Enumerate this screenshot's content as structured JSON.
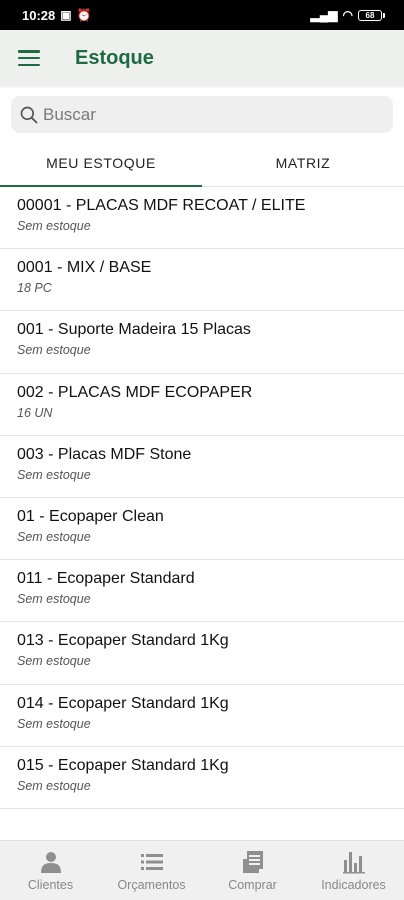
{
  "status_bar": {
    "time": "10:28",
    "battery": "68"
  },
  "app_bar": {
    "title": "Estoque"
  },
  "search": {
    "placeholder": "Buscar"
  },
  "tabs": [
    {
      "label": "MEU ESTOQUE",
      "active": true
    },
    {
      "label": "MATRIZ",
      "active": false
    }
  ],
  "items": [
    {
      "title": "00001 - PLACAS MDF RECOAT / ELITE",
      "subtitle": "Sem estoque"
    },
    {
      "title": "0001 - MIX / BASE",
      "subtitle": "18 PC"
    },
    {
      "title": "001 - Suporte Madeira 15 Placas",
      "subtitle": "Sem estoque"
    },
    {
      "title": "002 - PLACAS MDF ECOPAPER",
      "subtitle": "16 UN"
    },
    {
      "title": "003 - Placas MDF Stone",
      "subtitle": "Sem estoque"
    },
    {
      "title": "01 - Ecopaper Clean",
      "subtitle": "Sem estoque"
    },
    {
      "title": "011 - Ecopaper Standard",
      "subtitle": "Sem estoque"
    },
    {
      "title": "013 - Ecopaper Standard 1Kg",
      "subtitle": "Sem estoque"
    },
    {
      "title": "014 - Ecopaper Standard 1Kg",
      "subtitle": "Sem estoque"
    },
    {
      "title": "015 - Ecopaper Standard 1Kg",
      "subtitle": "Sem estoque"
    }
  ],
  "bottom_nav": [
    {
      "label": "Clientes",
      "icon": "person-icon"
    },
    {
      "label": "Orçamentos",
      "icon": "list-icon"
    },
    {
      "label": "Comprar",
      "icon": "receipt-icon"
    },
    {
      "label": "Indicadores",
      "icon": "bar-chart-icon"
    }
  ],
  "colors": {
    "primary": "#1e6b42",
    "appbar_bg": "#eef0ee"
  }
}
